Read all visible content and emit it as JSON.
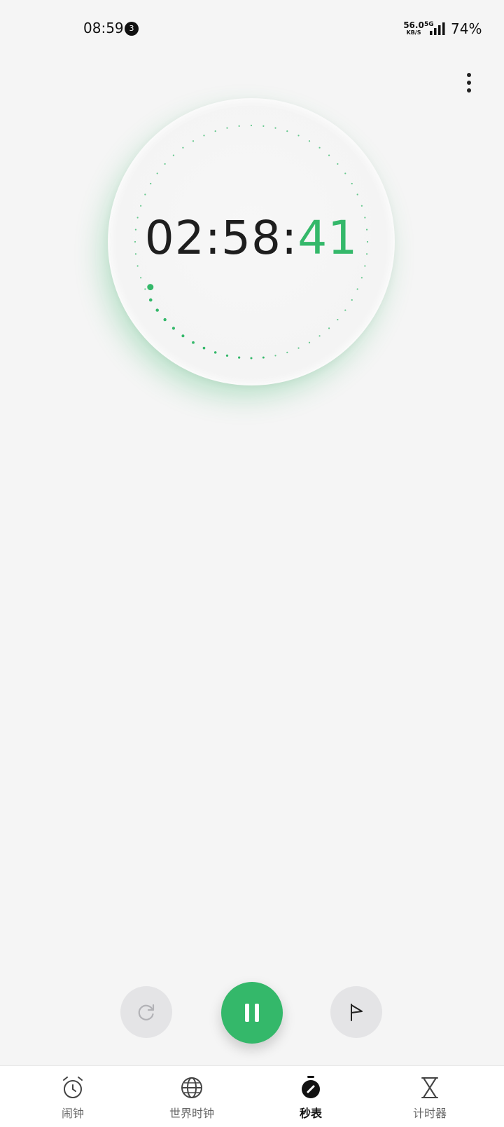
{
  "status_bar": {
    "time": "08:59",
    "notification_count": "3",
    "network_speed_value": "56.0",
    "network_speed_unit": "KB/S",
    "network_type": "5G",
    "battery": "74%"
  },
  "stopwatch": {
    "hours_minutes": "02:58:",
    "seconds": "41",
    "second_progress": 0.683
  },
  "controls": {
    "reset": "reset-icon",
    "pause": "pause-icon",
    "lap": "flag-icon"
  },
  "nav": {
    "items": [
      {
        "label": "闹钟",
        "icon": "alarm-clock-icon"
      },
      {
        "label": "世界时钟",
        "icon": "globe-icon"
      },
      {
        "label": "秒表",
        "icon": "stopwatch-icon"
      },
      {
        "label": "计时器",
        "icon": "hourglass-icon"
      }
    ],
    "active_index": 2
  },
  "colors": {
    "accent": "#34b86a",
    "background": "#f5f5f5",
    "button_gray": "#e4e4e6"
  }
}
